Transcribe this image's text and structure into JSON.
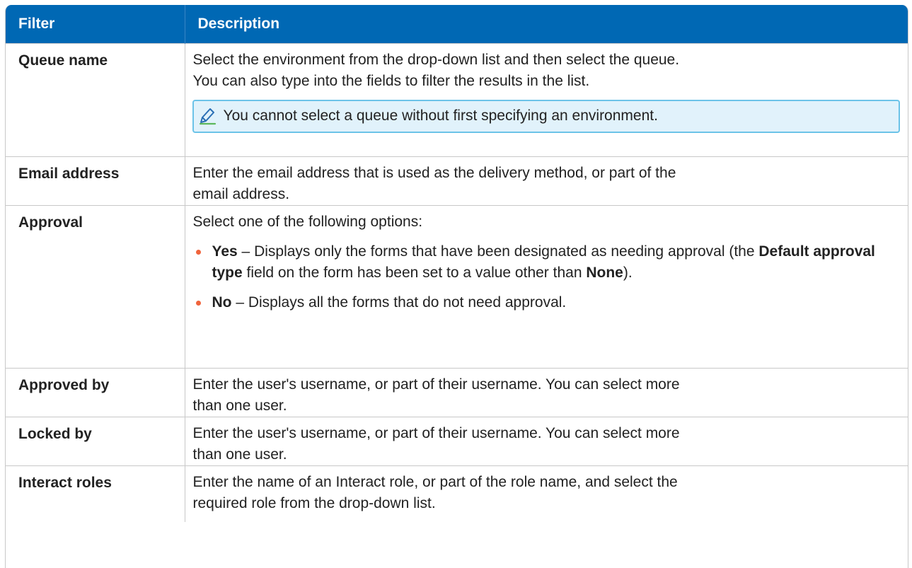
{
  "table": {
    "headers": {
      "filter": "Filter",
      "description": "Description"
    },
    "rows": {
      "queue": {
        "filter": "Queue name",
        "desc_line1": "Select the environment from the drop-down list and then select the queue.",
        "desc_line2": "You can also type into the fields to filter the results in the list.",
        "note": "You cannot select a queue without first specifying an environment.",
        "note_icon": "pencil-icon"
      },
      "email": {
        "filter": "Email address",
        "desc_line1": "Enter the email address that is used as the delivery method, or part of the",
        "desc_line2": "email address."
      },
      "approval": {
        "filter": "Approval",
        "intro": "Select one of the following options:",
        "bullet_yes": {
          "term": "Yes",
          "text_a": " – Displays only the forms that have been designated as needing approval (the ",
          "term2": "Default approval type",
          "text_b": " field on the form has been set to a value other than ",
          "term3": "None",
          "text_c": ")."
        },
        "bullet_no": {
          "term": "No",
          "text": " – Displays all the forms that do not need approval."
        }
      },
      "approved_by": {
        "filter": "Approved by",
        "desc_line1": "Enter the user's username, or part of their username. You can select more",
        "desc_line2": "than one user."
      },
      "locked_by": {
        "filter": "Locked by",
        "desc_line1": "Enter the user's username, or part of their username. You can select more",
        "desc_line2": "than one user."
      },
      "interact_roles": {
        "filter": "Interact roles",
        "desc_line1": "Enter the name of an Interact role, or part of the role name, and select the",
        "desc_line2": "required role from the drop-down list."
      }
    }
  },
  "colors": {
    "header_bg": "#0068b4",
    "note_bg": "#e1f2fb",
    "note_border": "#6cc3e8",
    "bullet": "#f0643c"
  }
}
